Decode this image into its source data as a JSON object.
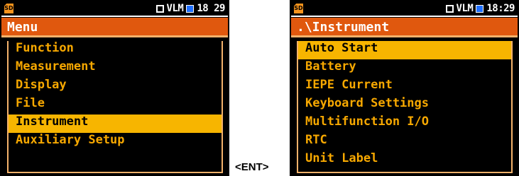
{
  "left_screen": {
    "status": {
      "text": "VLM",
      "time": "18 29"
    },
    "title": "Menu",
    "items": [
      "Function",
      "Measurement",
      "Display",
      "File",
      "Instrument",
      "Auxiliary Setup"
    ],
    "selected_index": 4
  },
  "transition_label": "<ENT>",
  "right_screen": {
    "status": {
      "text": "VLM",
      "time": "18:29"
    },
    "title": ".\\Instrument",
    "items": [
      "Auto Start",
      "Battery",
      "IEPE Current",
      "Keyboard Settings",
      "Multifunction I/O",
      "RTC",
      "Unit Label"
    ],
    "selected_index": 0
  },
  "colors": {
    "title_bar": "#e0580e",
    "item_text": "#f7a800",
    "highlight": "#f7b500",
    "status_square_blue": "#1f6fff"
  },
  "icons": {
    "sd_card": "sd-card-icon",
    "empty_square": "square-indicator-icon",
    "blue_square": "blue-square-indicator-icon"
  }
}
